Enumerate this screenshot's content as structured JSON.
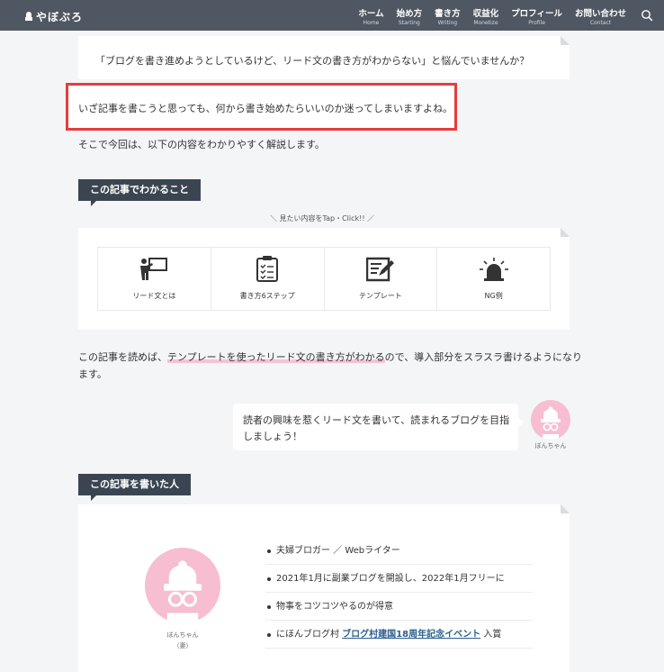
{
  "header": {
    "logo": "やぼぶろ",
    "nav": [
      {
        "label": "ホーム",
        "sub": "Home"
      },
      {
        "label": "始め方",
        "sub": "Starting"
      },
      {
        "label": "書き方",
        "sub": "Writing"
      },
      {
        "label": "収益化",
        "sub": "Monetize"
      },
      {
        "label": "プロフィール",
        "sub": "Profile"
      },
      {
        "label": "お問い合わせ",
        "sub": "Contact"
      }
    ]
  },
  "intro": {
    "quote": "「ブログを書き進めようとしているけど、リード文の書き方がわからない」と悩んでいませんか？",
    "highlighted_line": "いざ記事を書こうと思っても、何から書き始めたらいいのか迷ってしまいますよね。",
    "line3": "そこで今回は、以下の内容をわかりやすく解説します。"
  },
  "toc": {
    "label": "この記事でわかること",
    "hint": "＼ 見たい内容をTap・Click!! ／",
    "items": [
      {
        "label": "リード文とは",
        "icon": "teacher-board-icon"
      },
      {
        "label": "書き方6ステップ",
        "icon": "clipboard-checklist-icon"
      },
      {
        "label": "テンプレート",
        "icon": "edit-document-icon"
      },
      {
        "label": "NG例",
        "icon": "warning-siren-icon"
      }
    ]
  },
  "summary": {
    "before": "この記事を読めば、",
    "highlight": "テンプレートを使ったリード文の書き方がわかる",
    "after": "ので、導入部分をスラスラ書けるようになり",
    "line2": "ます。"
  },
  "speech": {
    "text": "読者の興味を惹くリード文を書いて、読まれるブログを目指しましょう！",
    "name": "ぼんちゃん"
  },
  "author": {
    "label": "この記事を書いた人",
    "name": "ぼんちゃん",
    "role": "（妻）",
    "bullets": [
      "夫婦ブロガー ／ Webライター",
      "2021年1月に副業ブログを開設し、2022年1月フリーに",
      "物事をコツコツやるのが得意"
    ],
    "award_prefix": "にほんブログ村",
    "award_link": "ブログ村建国18周年記念イベント",
    "award_suffix": "入賞"
  },
  "colors": {
    "header_bg": "#4f5762",
    "label_bg": "#3b4552",
    "highlight": "#f6c3d6",
    "avatar_bg": "#f7bdd0",
    "red_outline": "#e63c3c"
  }
}
